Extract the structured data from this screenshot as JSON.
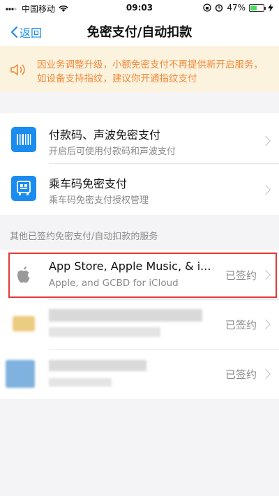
{
  "status_bar": {
    "carrier": "中国移动",
    "time": "09:03",
    "battery_percent": "47%",
    "battery_level": 0.47,
    "colors": {
      "battery": "#4cd964"
    }
  },
  "nav": {
    "back_label": "返回",
    "title": "免密支付/自动扣款"
  },
  "notice": {
    "text": "因业务调整升级，小额免密支付不再提供新开启服务，如设备支持指纹，建议你开通指纹支付"
  },
  "payment_options": [
    {
      "title": "付款码、声波免密支付",
      "subtitle": "开启后可使用付款码和声波支付",
      "icon": "barcode-icon"
    },
    {
      "title": "乘车码免密支付",
      "subtitle": "乘车码免密支付授权管理",
      "icon": "bus-qr-icon"
    }
  ],
  "section_label": "其他已签约免密支付/自动扣款的服务",
  "services": [
    {
      "title": "App Store, Apple Music, & i...",
      "subtitle": "Apple, and GCBD for iCloud",
      "status": "已签约",
      "icon": "apple-icon"
    },
    {
      "status": "已签约",
      "icon": "blurred-service-icon"
    },
    {
      "status": "已签约",
      "icon": "blurred-service-icon"
    }
  ],
  "colors": {
    "accent": "#1a8cf0",
    "notice_bg": "#fcf3de",
    "notice_text": "#f0883a",
    "highlight": "#e53935"
  }
}
